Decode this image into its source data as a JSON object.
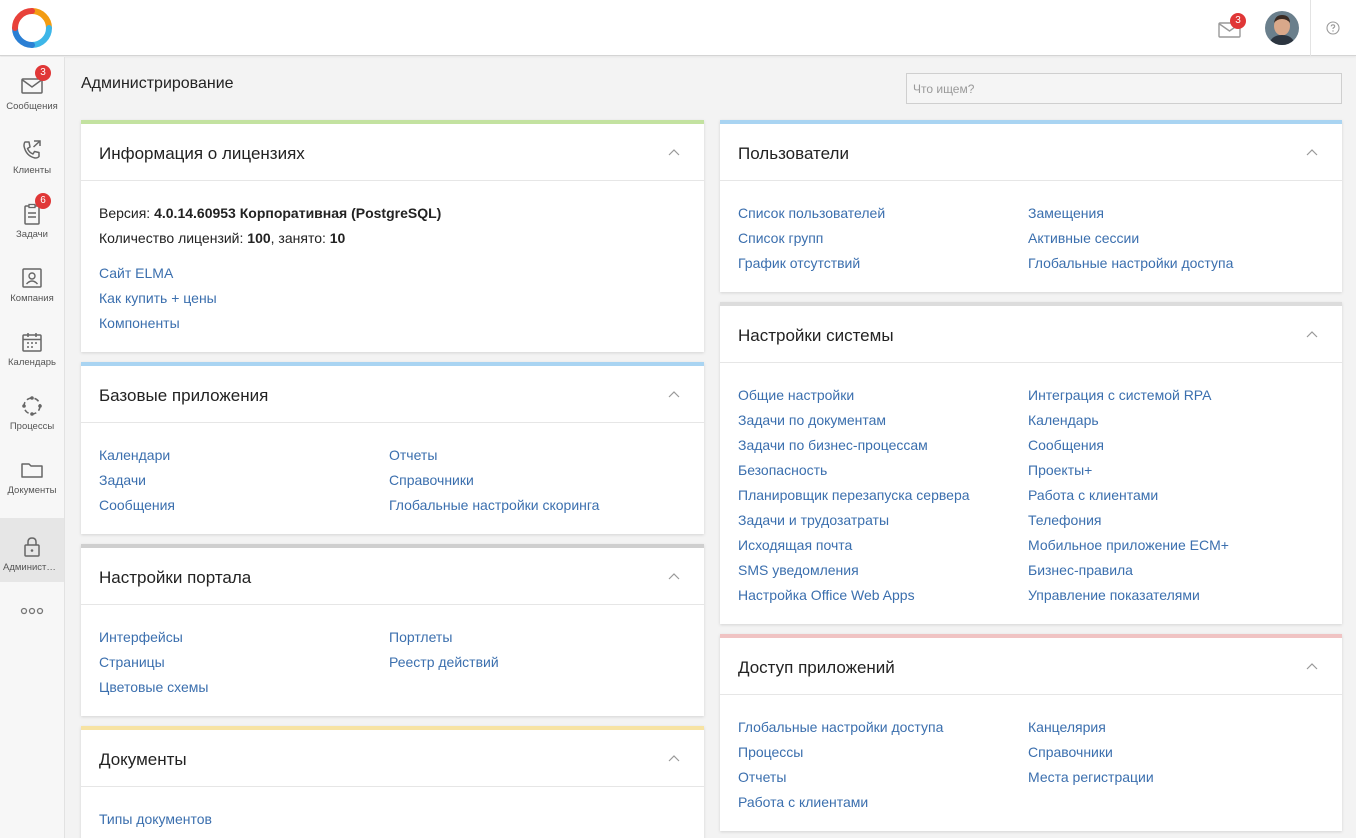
{
  "topbar": {
    "mail_badge": "3",
    "help_icon": "question-circle-icon"
  },
  "sidebar": {
    "items": [
      {
        "label": "Сообщения",
        "icon": "envelope-icon",
        "badge": "3"
      },
      {
        "label": "Клиенты",
        "icon": "phone-icon",
        "badge": ""
      },
      {
        "label": "Задачи",
        "icon": "clipboard-icon",
        "badge": "6"
      },
      {
        "label": "Компания",
        "icon": "company-icon",
        "badge": ""
      },
      {
        "label": "Календарь",
        "icon": "calendar-icon",
        "badge": ""
      },
      {
        "label": "Процессы",
        "icon": "process-icon",
        "badge": ""
      },
      {
        "label": "Документы",
        "icon": "folder-icon",
        "badge": ""
      },
      {
        "label": "Администрирование",
        "icon": "lock-icon",
        "badge": ""
      }
    ],
    "more_icon": "more-dots-icon"
  },
  "header": {
    "title": "Администрирование",
    "search_placeholder": "Что ищем?"
  },
  "colors": {
    "license": "#c3e2a0",
    "basic": "#a9d4f2",
    "portal": "#cfcfcf",
    "docs": "#f7e3a3",
    "users": "#a9d4f2",
    "system": "#dcdcdc",
    "access": "#f0c3c3",
    "link": "#3b6fae"
  },
  "license": {
    "title": "Информация о лицензиях",
    "version_label": "Версия: ",
    "version_value": "4.0.14.60953 Корпоративная (PostgreSQL)",
    "count_label": "Количество лицензий: ",
    "count_value": "100",
    "busy_label": ", занято: ",
    "busy_value": "10",
    "links": [
      "Сайт ELMA",
      "Как купить + цены",
      "Компоненты"
    ]
  },
  "basic_apps": {
    "title": "Базовые приложения",
    "col1": [
      "Календари",
      "Задачи",
      "Сообщения"
    ],
    "col2": [
      "Отчеты",
      "Справочники",
      "Глобальные настройки скоринга"
    ]
  },
  "portal": {
    "title": "Настройки портала",
    "col1": [
      "Интерфейсы",
      "Страницы",
      "Цветовые схемы"
    ],
    "col2": [
      "Портлеты",
      "Реестр действий"
    ]
  },
  "documents": {
    "title": "Документы",
    "col1": [
      "Типы документов"
    ]
  },
  "users": {
    "title": "Пользователи",
    "col1": [
      "Список пользователей",
      "Список групп",
      "График отсутствий"
    ],
    "col2": [
      "Замещения",
      "Активные сессии",
      "Глобальные настройки доступа"
    ]
  },
  "system": {
    "title": "Настройки системы",
    "col1": [
      "Общие настройки",
      "Задачи по документам",
      "Задачи по бизнес-процессам",
      "Безопасность",
      "Планировщик перезапуска сервера",
      "Задачи и трудозатраты",
      "Исходящая почта",
      "SMS уведомления",
      "Настройка Office Web Apps"
    ],
    "col2": [
      "Интеграция с системой RPA",
      "Календарь",
      "Сообщения",
      "Проекты+",
      "Работа с клиентами",
      "Телефония",
      "Мобильное приложение ECM+",
      "Бизнес-правила",
      "Управление показателями"
    ]
  },
  "app_access": {
    "title": "Доступ приложений",
    "col1": [
      "Глобальные настройки доступа",
      "Процессы",
      "Отчеты",
      "Работа с клиентами"
    ],
    "col2": [
      "Канцелярия",
      "Справочники",
      "Места регистрации"
    ]
  }
}
